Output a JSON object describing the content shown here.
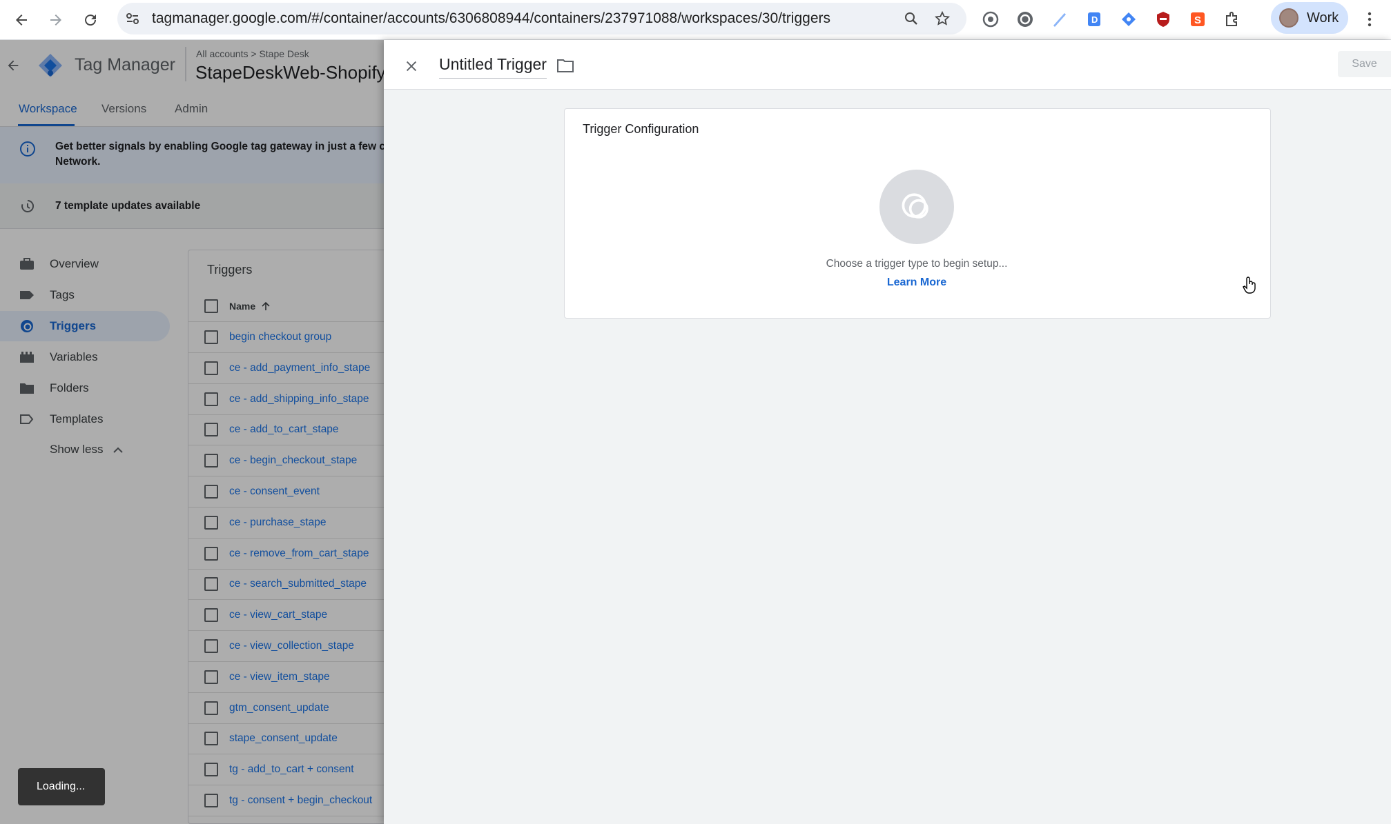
{
  "browser": {
    "url": "tagmanager.google.com/#/container/accounts/6306808944/containers/237971088/workspaces/30/triggers",
    "profile_label": "Work"
  },
  "app": {
    "product_name": "Tag Manager",
    "breadcrumb": "All accounts > Stape Desk",
    "container_name": "StapeDeskWeb-Shopify",
    "tabs": [
      "Workspace",
      "Versions",
      "Admin"
    ],
    "banner_text": "Get better signals by enabling Google tag gateway in just a few cli",
    "banner_text_2": "Network.",
    "template_updates": "7 template updates available"
  },
  "sidebar": {
    "items": [
      {
        "label": "Overview",
        "icon": "briefcase-icon"
      },
      {
        "label": "Tags",
        "icon": "tag-icon"
      },
      {
        "label": "Triggers",
        "icon": "trigger-icon",
        "active": true
      },
      {
        "label": "Variables",
        "icon": "variables-icon"
      },
      {
        "label": "Folders",
        "icon": "folder-icon"
      },
      {
        "label": "Templates",
        "icon": "template-icon"
      }
    ],
    "show_less": "Show less"
  },
  "triggers_list": {
    "title": "Triggers",
    "column_name": "Name",
    "rows": [
      "begin checkout group",
      "ce - add_payment_info_stape",
      "ce - add_shipping_info_stape",
      "ce - add_to_cart_stape",
      "ce - begin_checkout_stape",
      "ce - consent_event",
      "ce - purchase_stape",
      "ce - remove_from_cart_stape",
      "ce - search_submitted_stape",
      "ce - view_cart_stape",
      "ce - view_collection_stape",
      "ce - view_item_stape",
      "gtm_consent_update",
      "stape_consent_update",
      "tg - add_to_cart + consent",
      "tg - consent + begin_checkout"
    ]
  },
  "drawer": {
    "trigger_name": "Untitled Trigger",
    "save_label": "Save",
    "config_title": "Trigger Configuration",
    "config_hint": "Choose a trigger type to begin setup...",
    "learn_more": "Learn More"
  },
  "toast": "Loading...",
  "colors": {
    "accent": "#1a73e8",
    "active_bg": "#e8f0fe",
    "dim": "rgba(0,0,0,0.32)"
  }
}
